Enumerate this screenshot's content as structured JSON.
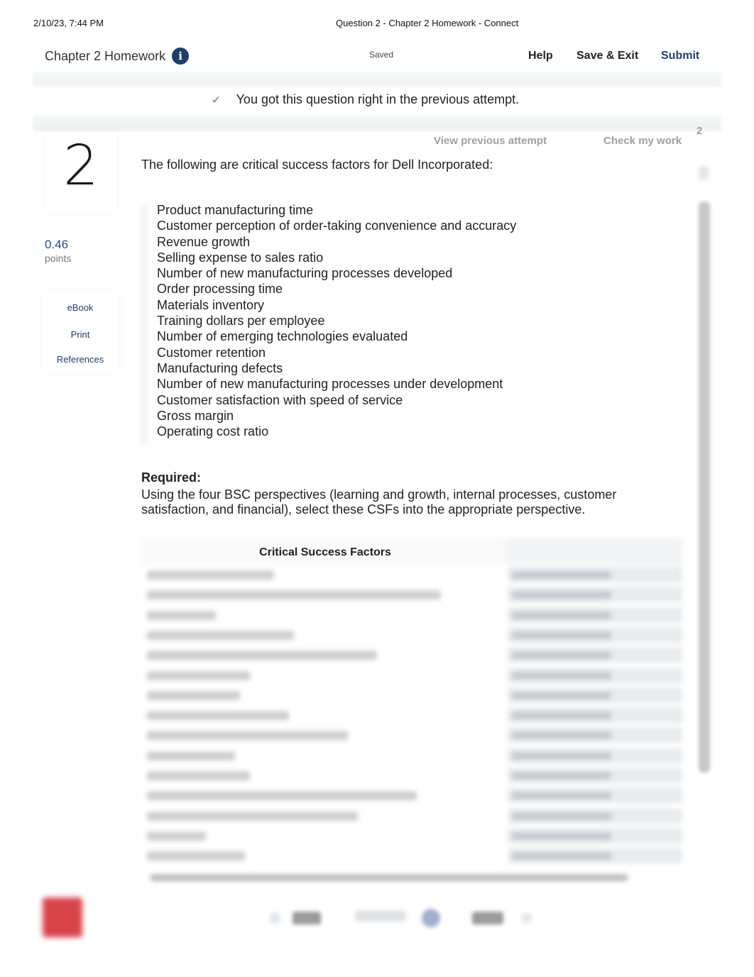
{
  "print_header": {
    "datetime": "2/10/23, 7:44 PM",
    "page_title": "Question 2 - Chapter 2 Homework - Connect"
  },
  "topbar": {
    "assignment_title": "Chapter 2 Homework",
    "info_icon": "i",
    "save_status": "Saved",
    "help_label": "Help",
    "save_exit_label": "Save & Exit",
    "submit_label": "Submit"
  },
  "notice": {
    "icon": "✔",
    "text": "You got this question right in the previous attempt."
  },
  "question": {
    "number": "2",
    "points_value": "0.46",
    "points_label": "points",
    "tools": [
      {
        "label": "eBook"
      },
      {
        "label": "Print"
      },
      {
        "label": "References"
      }
    ],
    "view_previous_label": "View previous attempt",
    "check_work_label": "Check my work",
    "check_work_count": "2",
    "intro": "The following are critical success factors for Dell Incorporated:",
    "csfs": [
      "Product manufacturing time",
      "Customer perception of order-taking convenience and accuracy",
      "Revenue growth",
      "Selling expense to sales ratio",
      "Number of new manufacturing processes developed",
      "Order processing time",
      "Materials inventory",
      "Training dollars per employee",
      "Number of emerging technologies evaluated",
      "Customer retention",
      "Manufacturing defects",
      "Number of new manufacturing processes under development",
      "Customer satisfaction with speed of service",
      "Gross margin",
      "Operating cost ratio"
    ],
    "required_label": "Required:",
    "required_text": "Using the four BSC perspectives (learning and growth, internal processes, customer satisfaction, and financial), select these CSFs into the appropriate perspective."
  },
  "table": {
    "header_factors": "Critical Success Factors",
    "header_perspective": "",
    "row_count": 15
  },
  "colors": {
    "brand_navy": "#1f3f69",
    "points_blue": "#1f4f86",
    "muted_gray": "#a0a0a0",
    "logo_red": "#d9434a"
  }
}
